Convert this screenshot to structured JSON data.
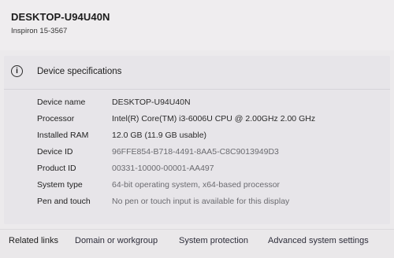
{
  "device": {
    "name": "DESKTOP-U94U40N",
    "model": "Inspiron 15-3567"
  },
  "specs_section": {
    "title": "Device specifications",
    "icon": "info-icon",
    "rows": [
      {
        "label": "Device name",
        "value": "DESKTOP-U94U40N"
      },
      {
        "label": "Processor",
        "value": "Intel(R) Core(TM) i3-6006U CPU @ 2.00GHz   2.00 GHz"
      },
      {
        "label": "Installed RAM",
        "value": "12.0 GB (11.9 GB usable)"
      },
      {
        "label": "Device ID",
        "value": "96FFE854-B718-4491-8AA5-C8C9013949D3"
      },
      {
        "label": "Product ID",
        "value": "00331-10000-00001-AA497"
      },
      {
        "label": "System type",
        "value": "64-bit operating system, x64-based processor"
      },
      {
        "label": "Pen and touch",
        "value": "No pen or touch input is available for this display"
      }
    ]
  },
  "related_links": {
    "title": "Related links",
    "links": [
      "Domain or workgroup",
      "System protection",
      "Advanced system settings"
    ]
  }
}
